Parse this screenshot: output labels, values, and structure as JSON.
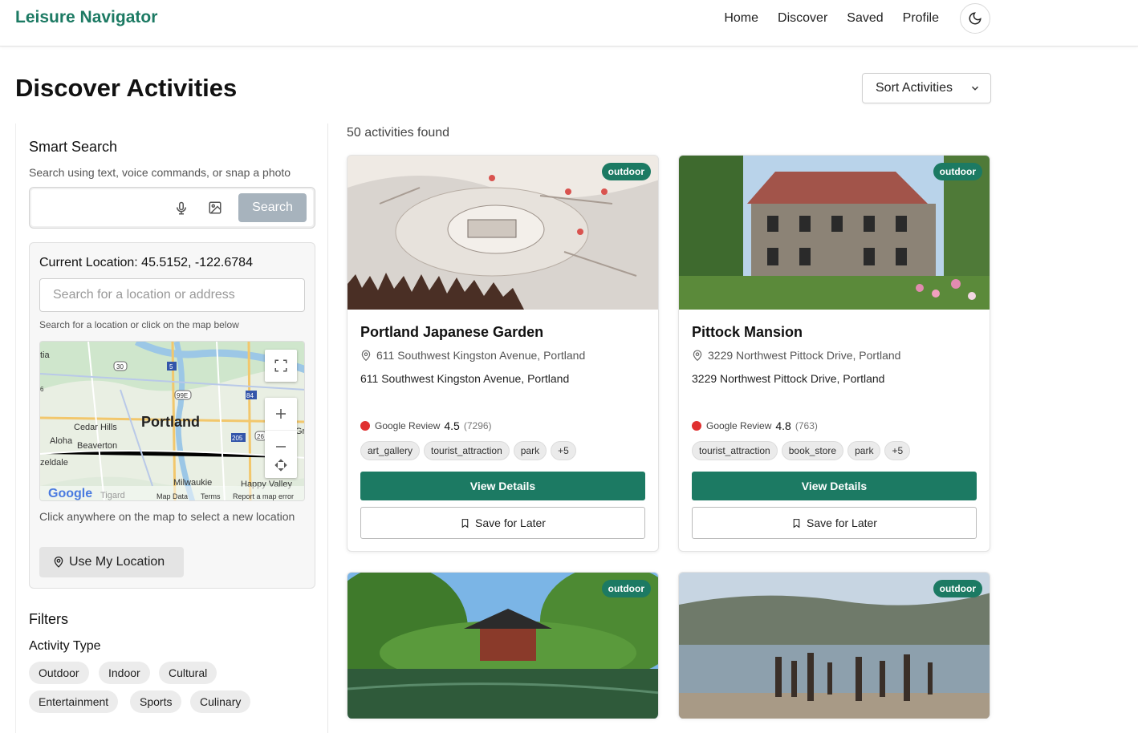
{
  "header": {
    "brand": "Leisure Navigator",
    "nav": [
      "Home",
      "Discover",
      "Saved",
      "Profile"
    ],
    "theme_icon": "moon-icon"
  },
  "page": {
    "title": "Discover Activities",
    "sort_label": "Sort Activities",
    "count_text": "50 activities found"
  },
  "smart_search": {
    "title": "Smart Search",
    "subtitle": "Search using text, voice commands, or snap a photo",
    "placeholder": "",
    "button": "Search"
  },
  "location": {
    "current": "Current Location: 45.5152, -122.6784",
    "placeholder": "Search for a location or address",
    "hint": "Search for a location or click on the map below",
    "caption": "Click anywhere on the map to select a new location",
    "use_my_location": "Use My Location",
    "map": {
      "city": "Portland",
      "places": [
        "tia",
        "Cedar Hills",
        "Aloha",
        "Beaverton",
        "zeldale",
        "Tigard",
        "Milwaukie",
        "Happy Valley",
        "Gr"
      ],
      "shields": [
        "30",
        "5",
        "99E",
        "84",
        "205",
        "26",
        "6"
      ],
      "attribution": [
        "Map Data",
        "Terms",
        "Report a map error"
      ],
      "logo": "Google"
    }
  },
  "filters": {
    "title": "Filters",
    "activity_type_label": "Activity Type",
    "activity_types": [
      "Outdoor",
      "Indoor",
      "Cultural",
      "Entertainment",
      "Sports",
      "Culinary"
    ]
  },
  "cards": [
    {
      "badge": "outdoor",
      "title": "Portland Japanese Garden",
      "address_line": "611 Southwest Kingston Avenue, Portland",
      "address": "611 Southwest Kingston Avenue, Portland",
      "review_label": "Google Review",
      "rating": "4.5",
      "review_count": "(7296)",
      "tags": [
        "art_gallery",
        "tourist_attraction",
        "park",
        "+5"
      ],
      "view_details": "View Details",
      "save_later": "Save for Later"
    },
    {
      "badge": "outdoor",
      "title": "Pittock Mansion",
      "address_line": "3229 Northwest Pittock Drive, Portland",
      "address": "3229 Northwest Pittock Drive, Portland",
      "review_label": "Google Review",
      "rating": "4.8",
      "review_count": "(763)",
      "tags": [
        "tourist_attraction",
        "book_store",
        "park",
        "+5"
      ],
      "view_details": "View Details",
      "save_later": "Save for Later"
    },
    {
      "badge": "outdoor"
    },
    {
      "badge": "outdoor"
    }
  ],
  "colors": {
    "accent": "#1c7a63",
    "review_dot": "#e03030"
  }
}
